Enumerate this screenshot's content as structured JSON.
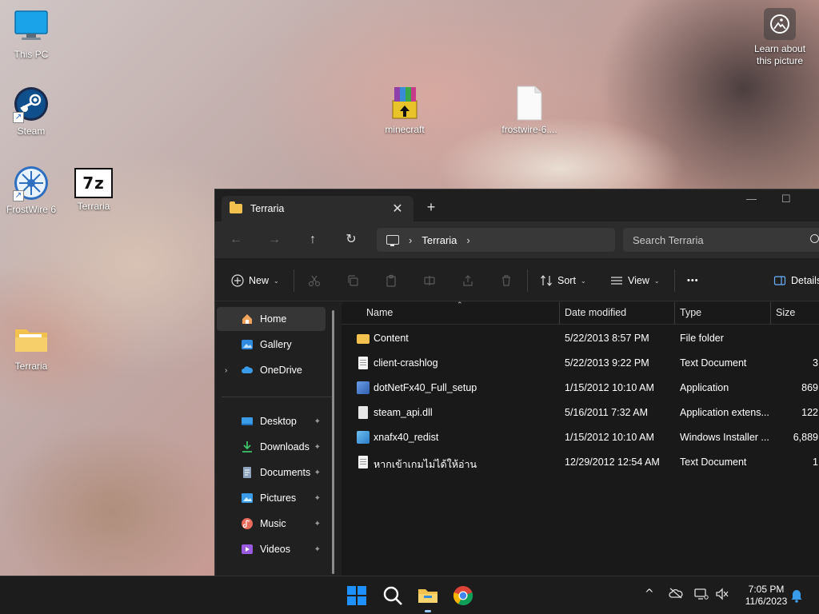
{
  "desktop": {
    "icons": [
      {
        "label": "This PC"
      },
      {
        "label": "Steam"
      },
      {
        "label": "FrostWire 6"
      },
      {
        "label": "Terraria"
      },
      {
        "label": "minecraft"
      },
      {
        "label": "frostwire-6...."
      },
      {
        "label": "Terraria"
      }
    ],
    "seven_zip_glyph": "7z",
    "learn": {
      "line1": "Learn about",
      "line2": "this picture"
    }
  },
  "explorer": {
    "tab_title": "Terraria",
    "close_glyph": "✕",
    "newtab_glyph": "+",
    "minimize_glyph": "—",
    "maximize_glyph": "☐",
    "nav": {
      "back": "←",
      "forward": "→",
      "up": "↑",
      "refresh": "↻"
    },
    "address": {
      "separator": "›",
      "crumb": "Terraria"
    },
    "search_placeholder": "Search Terraria",
    "commands": {
      "new_label": "New",
      "sort_label": "Sort",
      "view_label": "View",
      "more": "•••",
      "details_label": "Details",
      "caret": "⌄"
    },
    "nav_pane": {
      "items": [
        {
          "label": "Home"
        },
        {
          "label": "Gallery"
        },
        {
          "label": "OneDrive"
        },
        {
          "label": "Desktop"
        },
        {
          "label": "Downloads"
        },
        {
          "label": "Documents"
        },
        {
          "label": "Pictures"
        },
        {
          "label": "Music"
        },
        {
          "label": "Videos"
        }
      ],
      "pin_glyph": "📌",
      "expand_glyph": "›"
    },
    "columns": {
      "name": "Name",
      "date": "Date modified",
      "type": "Type",
      "size": "Size"
    },
    "files": [
      {
        "name": "Content",
        "date": "5/22/2013 8:57 PM",
        "type": "File folder",
        "size": ""
      },
      {
        "name": "client-crashlog",
        "date": "5/22/2013 9:22 PM",
        "type": "Text Document",
        "size": "3"
      },
      {
        "name": "dotNetFx40_Full_setup",
        "date": "1/15/2012 10:10 AM",
        "type": "Application",
        "size": "869"
      },
      {
        "name": "steam_api.dll",
        "date": "5/16/2011 7:32 AM",
        "type": "Application extens...",
        "size": "122"
      },
      {
        "name": "xnafx40_redist",
        "date": "1/15/2012 10:10 AM",
        "type": "Windows Installer ...",
        "size": "6,889"
      },
      {
        "name": "หากเข้าเกมไม่ได้ให้อ่าน",
        "date": "12/29/2012 12:54 AM",
        "type": "Text Document",
        "size": "1"
      }
    ]
  },
  "taskbar": {
    "time": "7:05 PM",
    "date": "11/6/2023",
    "tray_chevron": "^"
  },
  "colors": {
    "folder": "#f2c14e",
    "window_bg": "#202020",
    "taskbar_bg": "#1c1c1c",
    "win_blue": "#1e90ff"
  }
}
